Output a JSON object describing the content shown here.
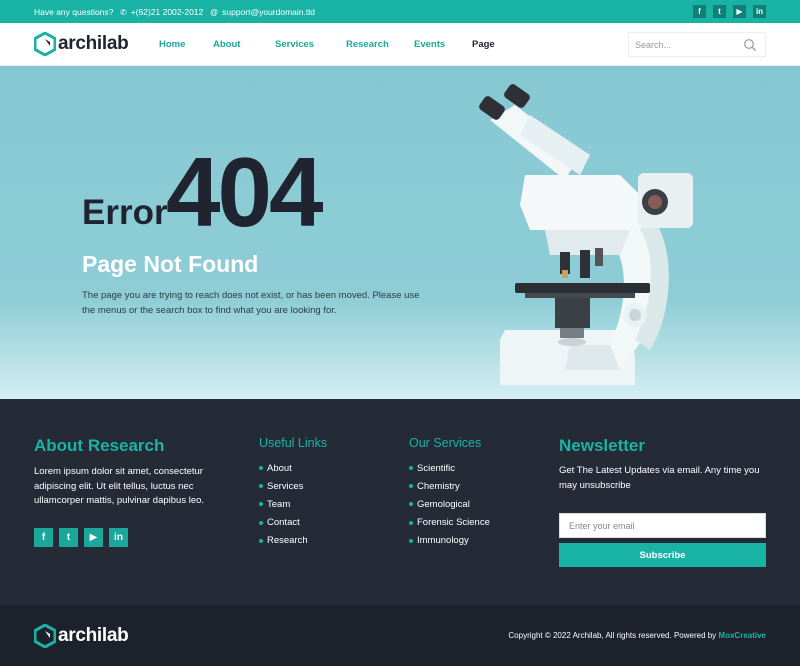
{
  "topbar": {
    "question": "Have any questions?",
    "phone": "+(62)21 2002-2012",
    "email": "support@yourdomain.tld",
    "phone_icon": "phone-icon",
    "mail_icon": "at-icon",
    "socials": [
      {
        "icon": "facebook-icon",
        "glyph": "f"
      },
      {
        "icon": "twitter-icon",
        "glyph": "t"
      },
      {
        "icon": "youtube-icon",
        "glyph": "▶"
      },
      {
        "icon": "linkedin-icon",
        "glyph": "in"
      }
    ]
  },
  "header": {
    "logo": "archilab",
    "nav": [
      "Home",
      "About",
      "Services",
      "Research",
      "Events",
      "Page"
    ],
    "active_nav": "Page",
    "search_placeholder": "Search..."
  },
  "hero": {
    "error_word": "Error",
    "error_code": "404",
    "title": "Page Not Found",
    "description": "The page you are trying to reach does not exist, or has been moved. Please use the menus or the search box to find what you are looking for."
  },
  "footer": {
    "about_title": "About Research",
    "about_text": "Lorem ipsum dolor sit amet, consectetur adipiscing elit. Ut elit tellus, luctus nec ullamcorper mattis, pulvinar dapibus leo.",
    "links_title": "Useful Links",
    "links": [
      "About",
      "Services",
      "Team",
      "Contact",
      "Research"
    ],
    "services_title": "Our Services",
    "services": [
      "Scientific",
      "Chemistry",
      "Gemological",
      "Forensic Science",
      "Immunology"
    ],
    "newsletter_title": "Newsletter",
    "newsletter_text": "Get The Latest Updates via email. Any time you may unsubscribe",
    "email_placeholder": "Enter your email",
    "subscribe_label": "Subscribe"
  },
  "bottom": {
    "logo": "archilab",
    "copyright": "Copyright © 2022 Archilab, All rights reserved. Powered by",
    "powered_by": "MoxCreative"
  },
  "colors": {
    "accent": "#19b3a6",
    "dark": "#242a36",
    "darker": "#1c212c",
    "hero_bg": "#8ecdd6"
  }
}
